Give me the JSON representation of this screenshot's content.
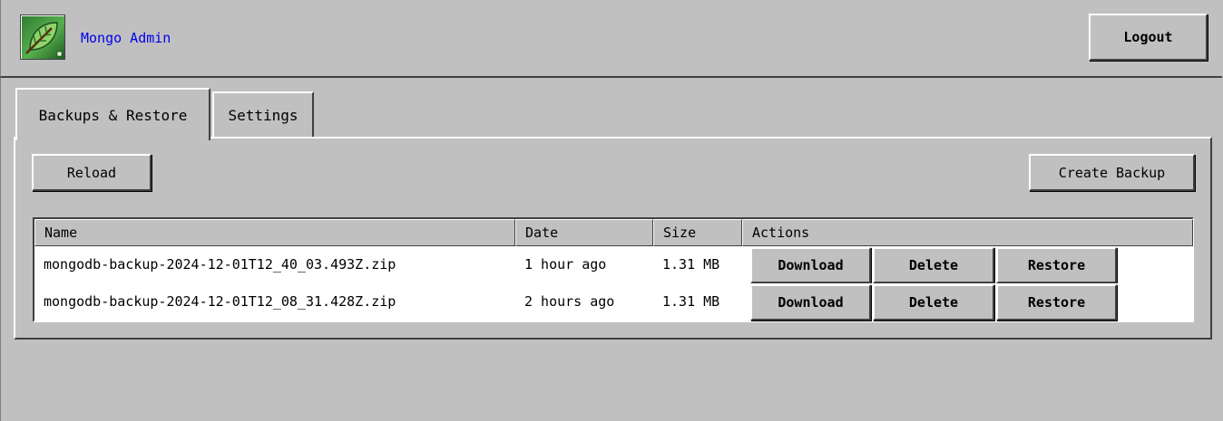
{
  "header": {
    "app_title": "Mongo Admin",
    "logout_label": "Logout",
    "logo_icon": "leaf-icon"
  },
  "tabs": [
    {
      "label": "Backups & Restore",
      "active": true
    },
    {
      "label": "Settings",
      "active": false
    }
  ],
  "toolbar": {
    "reload_label": "Reload",
    "create_backup_label": "Create Backup"
  },
  "table": {
    "columns": [
      "Name",
      "Date",
      "Size",
      "Actions"
    ],
    "rows": [
      {
        "name": "mongodb-backup-2024-12-01T12_40_03.493Z.zip",
        "date": "1 hour ago",
        "size": "1.31 MB"
      },
      {
        "name": "mongodb-backup-2024-12-01T12_08_31.428Z.zip",
        "date": "2 hours ago",
        "size": "1.31 MB"
      }
    ],
    "actions": {
      "download_label": "Download",
      "delete_label": "Delete",
      "restore_label": "Restore"
    }
  },
  "colors": {
    "background": "#c0c0c0",
    "link": "#0000ee",
    "highlight": "#ffffff",
    "shadow": "#404040"
  }
}
